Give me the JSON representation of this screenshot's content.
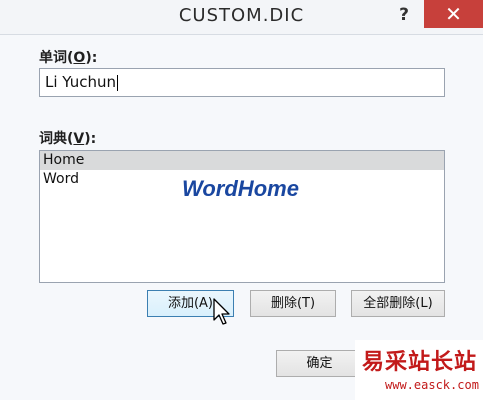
{
  "window": {
    "title": "CUSTOM.DIC",
    "help_label": "?",
    "close_label": "✕"
  },
  "word_field": {
    "label": "单词(",
    "label_key": "O",
    "label_suffix": "):",
    "value": "Li Yuchun"
  },
  "dictionary": {
    "label": "词典(",
    "label_key": "V",
    "label_suffix": "):",
    "items": [
      "Home",
      "Word"
    ],
    "selected": "Home"
  },
  "watermark_text": "WordHome",
  "buttons": {
    "add": "添加(A)",
    "delete": "删除(T)",
    "delete_all": "全部删除(L)",
    "ok": "确定"
  },
  "logo": {
    "chinese": "易采站长站",
    "url": "www.easck.com"
  }
}
